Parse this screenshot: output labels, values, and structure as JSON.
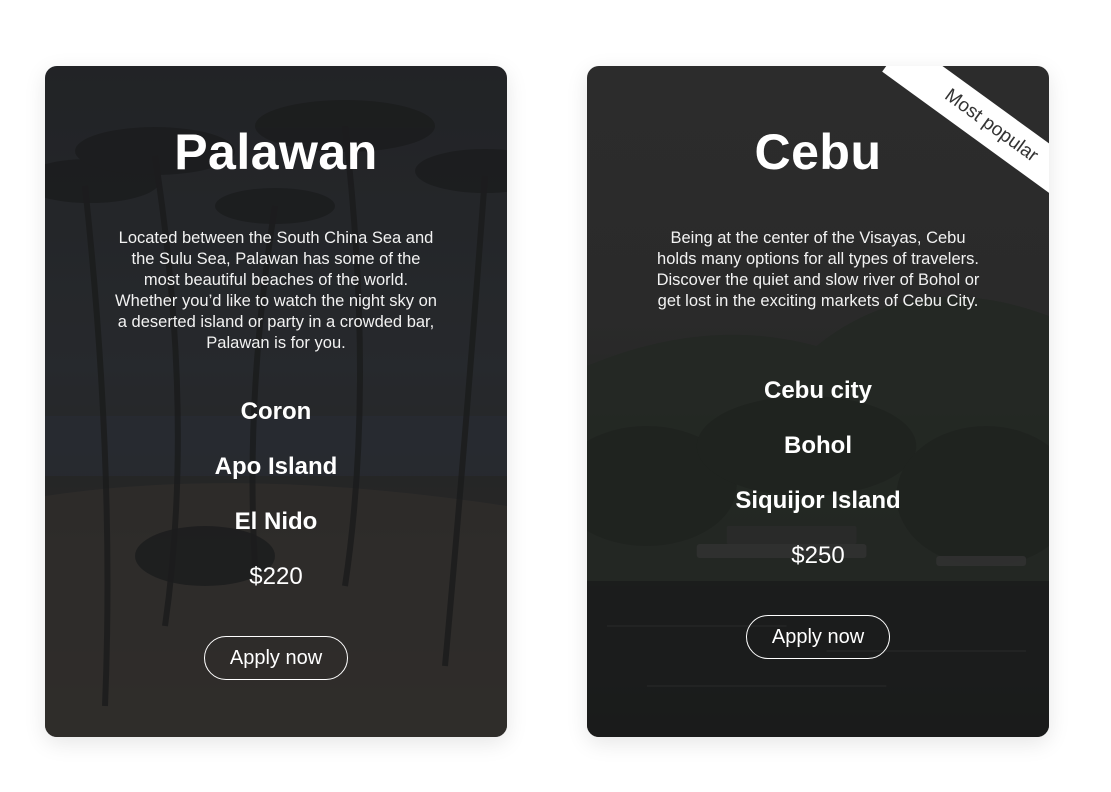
{
  "cards": [
    {
      "title": "Palawan",
      "description": "Located between the South China Sea and the Sulu Sea, Palawan has some of the most beautiful beaches of the world. Whether you’d like to watch the night sky on a deserted island or party in a crowded bar, Palawan is for you.",
      "destinations": [
        "Coron",
        "Apo Island",
        "El Nido"
      ],
      "price": "$220",
      "button_label": "Apply now"
    },
    {
      "title": "Cebu",
      "badge": "Most popular",
      "description": "Being at the center of the Visayas, Cebu holds many options for all types of travelers. Discover the quiet and slow river of Bohol or get lost in the exciting markets of Cebu City.",
      "destinations": [
        "Cebu city",
        "Bohol",
        "Siquijor Island"
      ],
      "price": "$250",
      "button_label": "Apply now"
    }
  ],
  "colors": {
    "card_overlay": "#2b2b2b",
    "text": "#ffffff",
    "ribbon_bg": "#ffffff",
    "ribbon_text": "#333333",
    "page_bg": "#ffffff"
  }
}
